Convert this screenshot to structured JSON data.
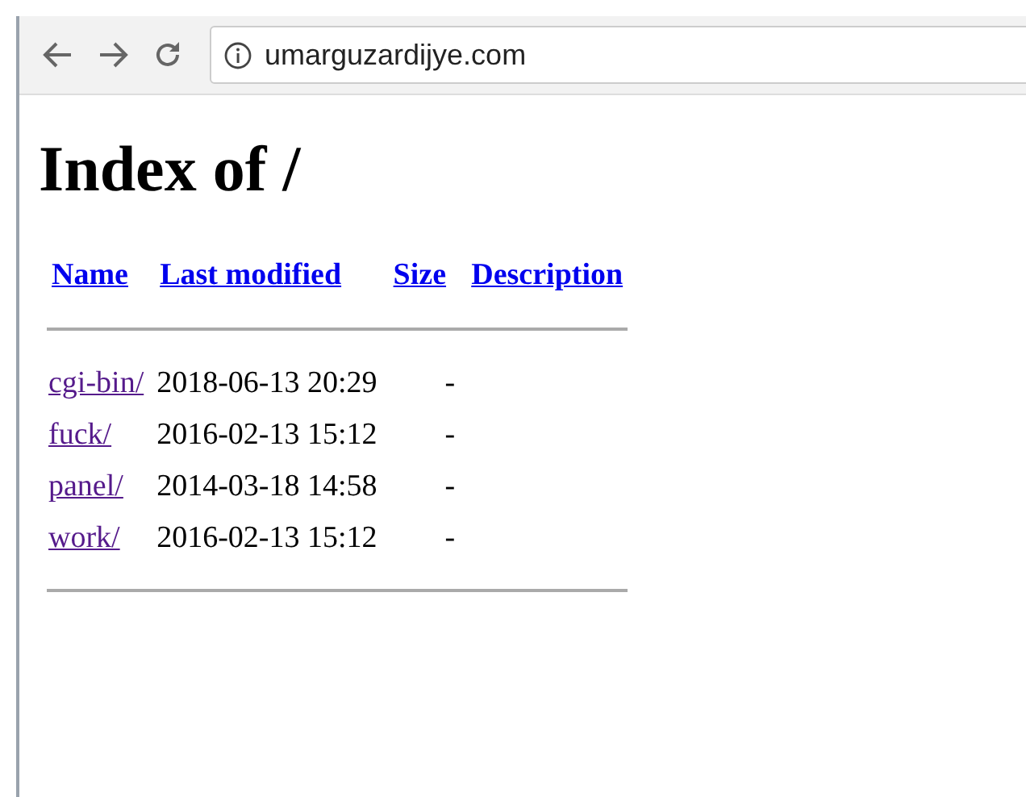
{
  "browser": {
    "url": "umarguzardijye.com"
  },
  "page": {
    "heading": "Index of /",
    "columns": [
      "Name",
      "Last modified",
      "Size",
      "Description"
    ],
    "rows": [
      {
        "name": "cgi-bin/",
        "modified": "2018-06-13 20:29",
        "size": "-",
        "visited": true
      },
      {
        "name": "fuck/",
        "modified": "2016-02-13 15:12",
        "size": "-",
        "visited": true
      },
      {
        "name": "panel/",
        "modified": "2014-03-18 14:58",
        "size": "-",
        "visited": true
      },
      {
        "name": "work/",
        "modified": "2016-02-13 15:12",
        "size": "-",
        "visited": true
      }
    ]
  }
}
